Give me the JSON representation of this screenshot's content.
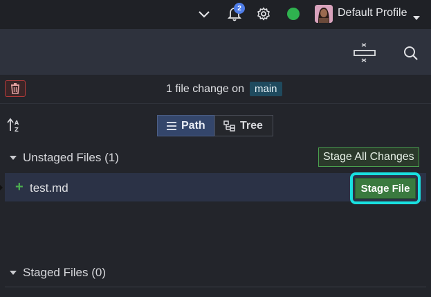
{
  "topbar": {
    "notification_count": "2",
    "profile_name": "Default Profile",
    "status_color": "#2fb24f",
    "icons": [
      "chevron-down-icon",
      "bell-icon",
      "gear-icon",
      "status-dot",
      "avatar",
      "caret-down-icon"
    ]
  },
  "toolbar": {
    "icons": [
      "commit-graph-icon",
      "search-icon"
    ]
  },
  "header": {
    "change_text": "1 file change on",
    "branch": "main"
  },
  "view_toggle": {
    "path_label": "Path",
    "tree_label": "Tree",
    "selected": "Path"
  },
  "unstaged": {
    "title": "Unstaged Files (1)",
    "stage_all_label": "Stage All Changes",
    "files": [
      {
        "name": "test.md",
        "status": "+",
        "action_label": "Stage File"
      }
    ]
  },
  "staged": {
    "title": "Staged Files (0)"
  },
  "colors": {
    "accent_green": "#3a7a3f",
    "highlight_ring": "#19e0e0",
    "branch_pill": "#1f4a5e",
    "delete_red": "#b23a3a"
  }
}
